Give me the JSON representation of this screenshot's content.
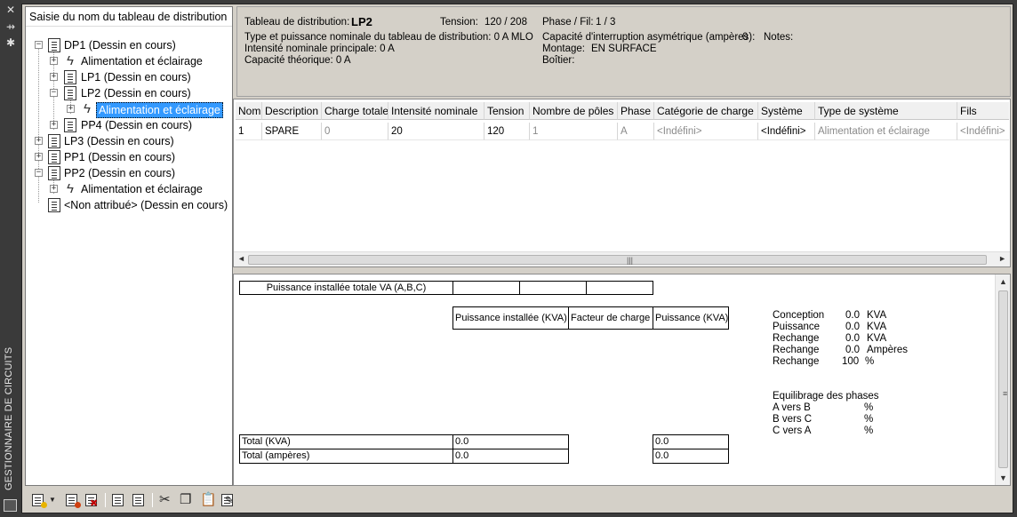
{
  "palette": {
    "window_bg": "#d4d0c8",
    "selection": "#3399ff",
    "title_strip": "#3a3a3a"
  },
  "title_strip": {
    "title": "GESTIONNAIRE DE CIRCUITS",
    "icons": [
      "close-icon",
      "pin-icon",
      "properties-icon"
    ]
  },
  "tree": {
    "header": "Saisie du nom du tableau de distribution",
    "items": [
      {
        "label": "DP1 (Dessin en cours)",
        "icon": "panel-icon",
        "expander": "−"
      },
      {
        "label": "Alimentation et éclairage",
        "icon": "lightning-icon",
        "expander": "+"
      },
      {
        "label": "LP1 (Dessin en cours)",
        "icon": "panel-icon",
        "expander": "+"
      },
      {
        "label": "LP2 (Dessin en cours)",
        "icon": "panel-icon",
        "expander": "−"
      },
      {
        "label": "Alimentation et éclairage",
        "icon": "lightning-icon",
        "expander": "+",
        "selected": true
      },
      {
        "label": "PP4 (Dessin en cours)",
        "icon": "panel-icon",
        "expander": "+"
      },
      {
        "label": "LP3 (Dessin en cours)",
        "icon": "panel-icon",
        "expander": "+"
      },
      {
        "label": "PP1 (Dessin en cours)",
        "icon": "panel-icon",
        "expander": "+"
      },
      {
        "label": "PP2 (Dessin en cours)",
        "icon": "panel-icon",
        "expander": "−"
      },
      {
        "label": "Alimentation et éclairage",
        "icon": "lightning-icon",
        "expander": "+"
      },
      {
        "label": "<Non attribué> (Dessin en cours)",
        "icon": "panel-icon",
        "expander": ""
      }
    ]
  },
  "info": {
    "panel_label": "Tableau de distribution:",
    "panel_value": "LP2",
    "voltage_label": "Tension:",
    "voltage_value": "120 / 208",
    "phase_label": "Phase / Fil:",
    "phase_value": "1 /  3",
    "rating_text": "Type et puissance nominale du tableau de distribution: 0 A MLO",
    "main_amp_text": "Intensité nominale principale: 0 A",
    "theoretical_text": "Capacité théorique: 0 A",
    "aic_label": "Capacité d'interruption asymétrique (ampères):",
    "aic_value": "0",
    "mounting_label": "Montage:",
    "mounting_value": "EN SURFACE",
    "enclosure_label": "Boîtier:",
    "notes_label": "Notes:"
  },
  "grid": {
    "columns": [
      "Nom",
      "Description",
      "Charge totale",
      "Intensité nominale",
      "Tension",
      "Nombre de pôles",
      "Phase",
      "Catégorie de charge",
      "Système",
      "Type de système",
      "Fils"
    ],
    "rows": [
      [
        "1",
        "SPARE",
        "0",
        "20",
        "120",
        "1",
        "A",
        "<Indéfini>",
        "<Indéfini>",
        "Alimentation et éclairage",
        "<Indéfini>"
      ]
    ]
  },
  "summary": {
    "total_va_label": "Puissance installée totale VA (A,B,C)",
    "col_installed": "Puissance installée (KVA)",
    "col_factor": "Facteur de charge",
    "col_power": "Puissance (KVA)",
    "total_kva_label": "Total (KVA)",
    "total_kva_installed": "0.0",
    "total_kva_power": "0.0",
    "total_amp_label": "Total (ampères)",
    "total_amp_installed": "0.0",
    "total_amp_power": "0.0",
    "stats": [
      {
        "label": "Conception",
        "value": "0.0",
        "unit": "KVA"
      },
      {
        "label": "Puissance",
        "value": "0.0",
        "unit": "KVA"
      },
      {
        "label": "Rechange",
        "value": "0.0",
        "unit": "KVA"
      },
      {
        "label": "Rechange",
        "value": "0.0",
        "unit": "Ampères"
      },
      {
        "label": "Rechange",
        "value": "100",
        "unit": "%"
      }
    ],
    "balance_title": "Equilibrage des phases",
    "balance": [
      {
        "label": "A vers B",
        "unit": "%"
      },
      {
        "label": "B vers C",
        "unit": "%"
      },
      {
        "label": "C vers A",
        "unit": "%"
      }
    ]
  },
  "toolbar": {
    "buttons": [
      "new-panel-icon",
      "new-panel-dropdown-icon",
      "panel-properties-icon",
      "delete-panel-icon",
      "copy-panel-icon",
      "paste-panel-icon",
      "cut-icon",
      "copy-icon",
      "paste-icon",
      "edit-panel-icon"
    ]
  }
}
